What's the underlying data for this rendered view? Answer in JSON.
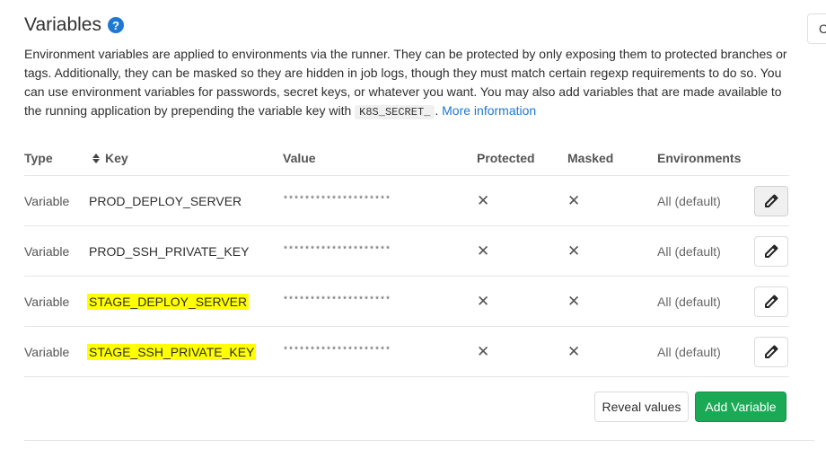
{
  "header": {
    "title": "Variables",
    "help_glyph": "?",
    "collapse_label": "C"
  },
  "description": {
    "text_before_code": "Environment variables are applied to environments via the runner. They can be protected by only exposing them to protected branches or tags. Additionally, they can be masked so they are hidden in job logs, though they must match certain regexp requirements to do so. You can use environment variables for passwords, secret keys, or whatever you want. You may also add variables that are made available to the running application by prepending the variable key with",
    "code": "K8S_SECRET_",
    "text_after_code": ".",
    "link_label": "More information"
  },
  "table": {
    "headers": {
      "type": "Type",
      "key": "Key",
      "value": "Value",
      "protected": "Protected",
      "masked": "Masked",
      "environments": "Environments"
    },
    "rows": [
      {
        "type": "Variable",
        "key": "PROD_DEPLOY_SERVER",
        "value": "********************",
        "protected": "✕",
        "masked": "✕",
        "environment": "All (default)",
        "highlighted": false
      },
      {
        "type": "Variable",
        "key": "PROD_SSH_PRIVATE_KEY",
        "value": "********************",
        "protected": "✕",
        "masked": "✕",
        "environment": "All (default)",
        "highlighted": false
      },
      {
        "type": "Variable",
        "key": "STAGE_DEPLOY_SERVER",
        "value": "********************",
        "protected": "✕",
        "masked": "✕",
        "environment": "All (default)",
        "highlighted": true
      },
      {
        "type": "Variable",
        "key": "STAGE_SSH_PRIVATE_KEY",
        "value": "********************",
        "protected": "✕",
        "masked": "✕",
        "environment": "All (default)",
        "highlighted": true
      }
    ]
  },
  "actions": {
    "reveal_label": "Reveal values",
    "add_label": "Add Variable"
  },
  "colors": {
    "link": "#1f78d1",
    "primary_green": "#1aaa55",
    "highlight": "#ffff00"
  },
  "icons": {
    "help": "question-circle-icon",
    "sort": "sort-icon",
    "edit": "pencil-icon",
    "boolean_false": "close-x-icon"
  }
}
